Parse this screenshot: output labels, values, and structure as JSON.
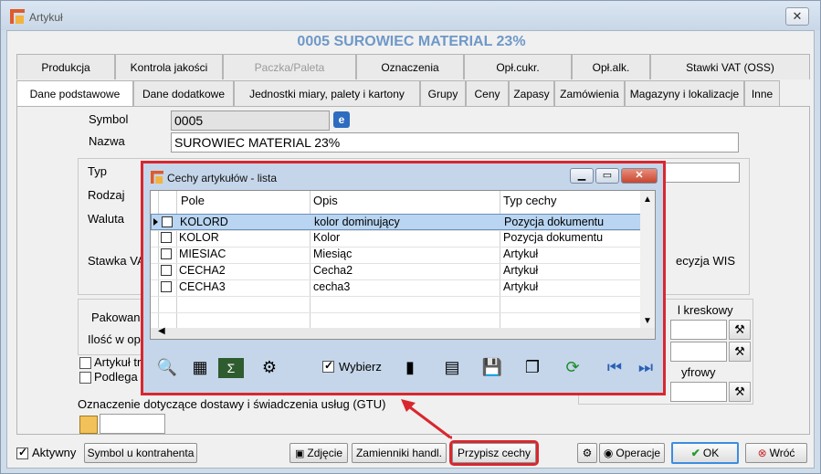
{
  "window": {
    "title": "Artykuł",
    "header": "0005  SUROWIEC MATERIAL 23%",
    "close_glyph": "✕"
  },
  "tabs_row1": [
    {
      "label": "Produkcja",
      "disabled": false
    },
    {
      "label": "Kontrola jakości",
      "disabled": false
    },
    {
      "label": "Paczka/Paleta",
      "disabled": true
    },
    {
      "label": "Oznaczenia",
      "disabled": false
    },
    {
      "label": "Opł.cukr.",
      "disabled": false
    },
    {
      "label": "Opł.alk.",
      "disabled": false
    },
    {
      "label": "Stawki VAT (OSS)",
      "disabled": false
    }
  ],
  "tabs_row2": [
    {
      "label": "Dane podstawowe",
      "active": true
    },
    {
      "label": "Dane dodatkowe"
    },
    {
      "label": "Jednostki miary, palety i kartony"
    },
    {
      "label": "Grupy"
    },
    {
      "label": "Ceny"
    },
    {
      "label": "Zapasy"
    },
    {
      "label": "Zamówienia"
    },
    {
      "label": "Magazyny i lokalizacje"
    },
    {
      "label": "Inne"
    }
  ],
  "form": {
    "symbol_label": "Symbol",
    "symbol_value": "0005",
    "nazwa_label": "Nazwa",
    "nazwa_value": "SUROWIEC MATERIAL 23%",
    "typ_label": "Typ",
    "rodzaj_label": "Rodzaj",
    "waluta_label": "Waluta",
    "stawka_label": "Stawka VA",
    "ewidencja_partial": "ecyzja WIS",
    "kreskowy_partial": "l kreskowy",
    "cyfrowy_partial": "yfrowy",
    "pakowane_label": "Pakowane",
    "ilosc_label": "Ilość w opa",
    "artykul_partial": "Artykuł tra",
    "podlega_partial": "Podlega z",
    "gtu_label": "Oznaczenie dotyczące dostawy i świadczenia usług (GTU)"
  },
  "dialog": {
    "title": "Cechy artykułów - lista",
    "columns": [
      "Pole",
      "Opis",
      "Typ cechy"
    ],
    "rows": [
      {
        "pole": "KOLORD",
        "opis": "kolor dominujący",
        "typ": "Pozycja dokumentu",
        "selected": true
      },
      {
        "pole": "KOLOR",
        "opis": "Kolor",
        "typ": "Pozycja dokumentu",
        "selected": false
      },
      {
        "pole": "MIESIAC",
        "opis": "Miesiąc",
        "typ": "Artykuł",
        "selected": false
      },
      {
        "pole": "CECHA2",
        "opis": "Cecha2",
        "typ": "Artykuł",
        "selected": false
      },
      {
        "pole": "CECHA3",
        "opis": "cecha3",
        "typ": "Artykuł",
        "selected": false
      }
    ],
    "wybierz_label": "Wybierz",
    "icons": [
      "binoculars-icon",
      "calculator-icon",
      "sum-icon",
      "gears-icon",
      "chart-icon",
      "document-icon",
      "save-icon",
      "windows-icon",
      "refresh-icon",
      "prev-icon",
      "next-icon"
    ]
  },
  "bottom": {
    "aktywny_label": "Aktywny",
    "symbol_kontrahenta": "Symbol u kontrahenta",
    "zdjecie": "Zdjęcie",
    "zamienniki": "Zamienniki handl.",
    "przypisz": "Przypisz cechy",
    "operacje": "Operacje",
    "ok": "OK",
    "wroc": "Wróć"
  },
  "colors": {
    "highlight": "#d9272e",
    "header_text": "#6e98c8",
    "selected_row": "#b9d5f1"
  }
}
